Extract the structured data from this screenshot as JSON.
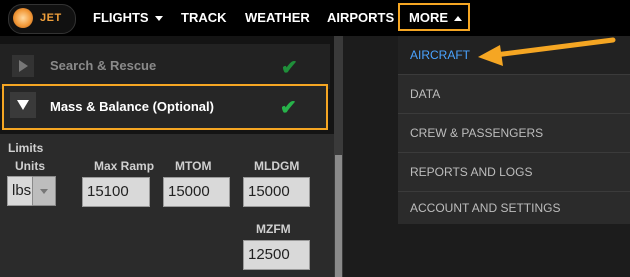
{
  "nav": {
    "logo_text": "JET",
    "flights": "FLIGHTS",
    "track": "TRACK",
    "weather": "WEATHER",
    "airports": "AIRPORTS",
    "more": "MORE"
  },
  "sections": {
    "search_rescue": "Search & Rescue",
    "mass_balance": "Mass & Balance (Optional)"
  },
  "limits": {
    "title": "Limits",
    "units_label": "Units",
    "units_value": "lbs",
    "max_ramp_label": "Max Ramp",
    "max_ramp_value": "15100",
    "mtom_label": "MTOM",
    "mtom_value": "15000",
    "mldgm_label": "MLDGM",
    "mldgm_value": "15000",
    "mzfm_label": "MZFM",
    "mzfm_value": "12500"
  },
  "dropdown": {
    "items": [
      "AIRCRAFT",
      "DATA",
      "CREW & PASSENGERS",
      "REPORTS AND LOGS",
      "ACCOUNT AND SETTINGS"
    ]
  },
  "icons": {
    "check": "✔"
  },
  "colors": {
    "accent_orange": "#f5a623",
    "check_green": "#27b34a",
    "link_blue": "#4aa3ff"
  }
}
